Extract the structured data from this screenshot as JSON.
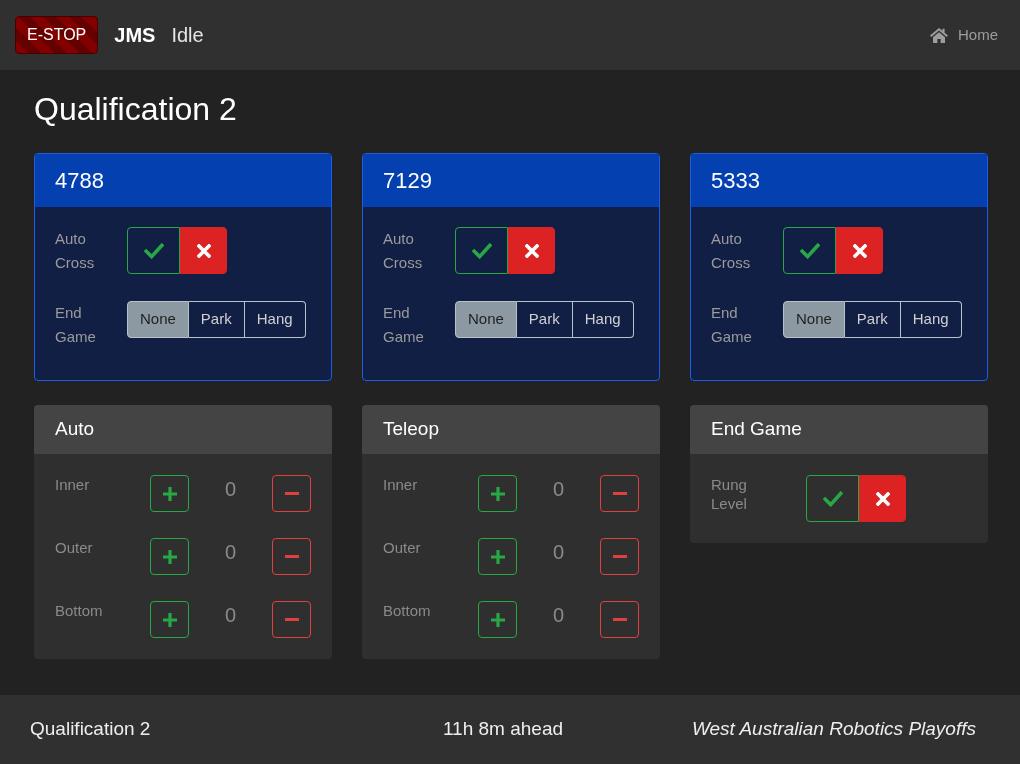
{
  "navbar": {
    "estop": "E-STOP",
    "brand": "JMS",
    "status": "Idle",
    "home_link": "Home"
  },
  "page_title": "Qualification 2",
  "teams": [
    {
      "number": "4788",
      "auto_cross": {
        "label": "Auto Cross",
        "options": [
          {
            "kind": "yes",
            "selected": false
          },
          {
            "kind": "no",
            "selected": true
          }
        ]
      },
      "end_game": {
        "label": "End Game",
        "options": [
          {
            "label": "None",
            "selected": true
          },
          {
            "label": "Park",
            "selected": false
          },
          {
            "label": "Hang",
            "selected": false
          }
        ]
      }
    },
    {
      "number": "7129",
      "auto_cross": {
        "label": "Auto Cross",
        "options": [
          {
            "kind": "yes",
            "selected": false
          },
          {
            "kind": "no",
            "selected": true
          }
        ]
      },
      "end_game": {
        "label": "End Game",
        "options": [
          {
            "label": "None",
            "selected": true
          },
          {
            "label": "Park",
            "selected": false
          },
          {
            "label": "Hang",
            "selected": false
          }
        ]
      }
    },
    {
      "number": "5333",
      "auto_cross": {
        "label": "Auto Cross",
        "options": [
          {
            "kind": "yes",
            "selected": false
          },
          {
            "kind": "no",
            "selected": true
          }
        ]
      },
      "end_game": {
        "label": "End Game",
        "options": [
          {
            "label": "None",
            "selected": true
          },
          {
            "label": "Park",
            "selected": false
          },
          {
            "label": "Hang",
            "selected": false
          }
        ]
      }
    }
  ],
  "score_panels": [
    {
      "title": "Auto",
      "rows": [
        {
          "kind": "counter",
          "label": "Inner",
          "count": "0"
        },
        {
          "kind": "counter",
          "label": "Outer",
          "count": "0"
        },
        {
          "kind": "counter",
          "label": "Bottom",
          "count": "0"
        }
      ]
    },
    {
      "title": "Teleop",
      "rows": [
        {
          "kind": "counter",
          "label": "Inner",
          "count": "0"
        },
        {
          "kind": "counter",
          "label": "Outer",
          "count": "0"
        },
        {
          "kind": "counter",
          "label": "Bottom",
          "count": "0"
        }
      ]
    },
    {
      "title": "End Game",
      "rows": [
        {
          "kind": "toggle",
          "label": "Rung Level",
          "options": [
            {
              "kind": "yes",
              "selected": false
            },
            {
              "kind": "no",
              "selected": true
            }
          ]
        }
      ]
    }
  ],
  "footer": {
    "match": "Qualification 2",
    "schedule": "11h 8m ahead",
    "event": "West Australian Robotics Playoffs"
  }
}
